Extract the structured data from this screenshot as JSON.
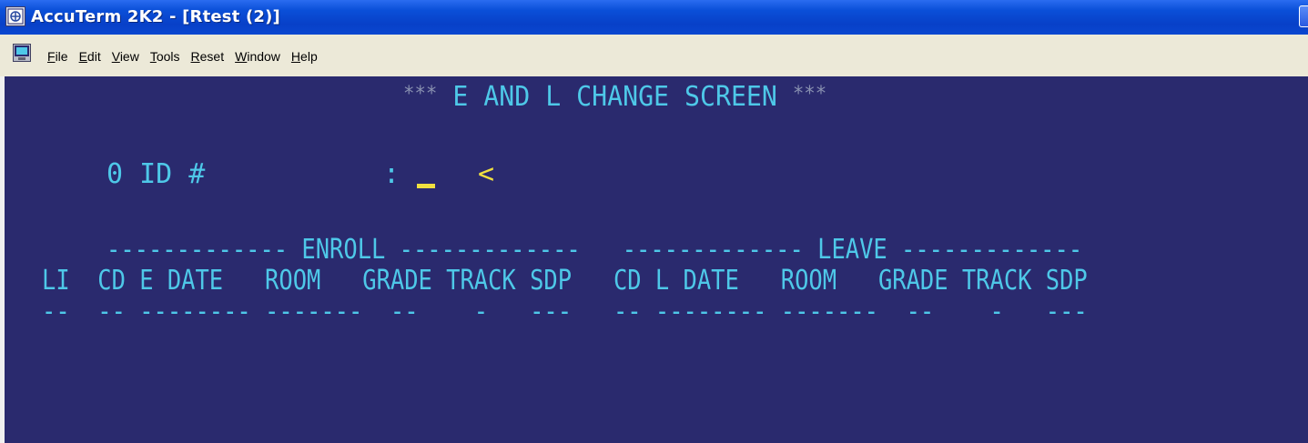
{
  "window": {
    "title": "AccuTerm 2K2 - [Rtest (2)]",
    "app_icon": "terminal-app-icon"
  },
  "menu": {
    "icon": "session-icon",
    "items": [
      {
        "label": "File",
        "accel": "F",
        "rest": "ile"
      },
      {
        "label": "Edit",
        "accel": "E",
        "rest": "dit"
      },
      {
        "label": "View",
        "accel": "V",
        "rest": "iew"
      },
      {
        "label": "Tools",
        "accel": "T",
        "rest": "ools"
      },
      {
        "label": "Reset",
        "accel": "R",
        "rest": "eset"
      },
      {
        "label": "Window",
        "accel": "W",
        "rest": "indow"
      },
      {
        "label": "Help",
        "accel": "H",
        "rest": "elp"
      }
    ]
  },
  "screen": {
    "stars_left": "***",
    "title": " E AND L CHANGE SCREEN ",
    "stars_right": "***",
    "id_label": "0 ID #",
    "id_colon": ":",
    "id_value": "",
    "id_marker": "<",
    "section_line": "------------- ENROLL -------------   ------------- LEAVE -------------",
    "column_line": "LI  CD E DATE   ROOM   GRADE TRACK SDP   CD L DATE   ROOM   GRADE TRACK SDP",
    "dash_line": "--  -- -------- -------  --    -   ---   -- -------- -------  --    -   ---"
  },
  "colors": {
    "terminal_bg": "#2a2a6e",
    "terminal_text": "#4ec8e8",
    "terminal_highlight": "#f0e040",
    "titlebar": "#0a4fd8",
    "menubar": "#ece9d8"
  }
}
